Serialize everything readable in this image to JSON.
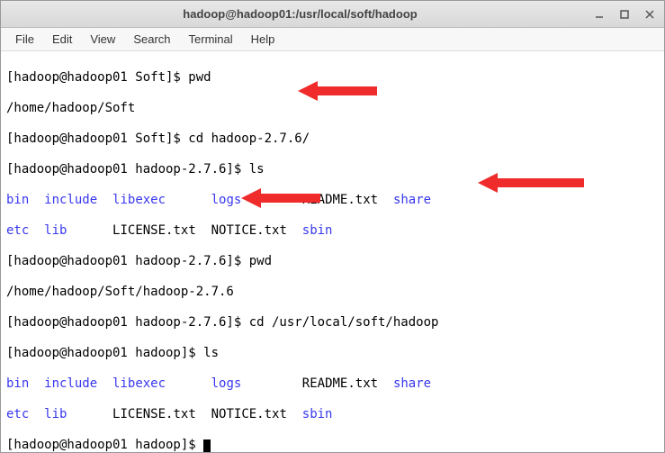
{
  "window": {
    "title": "hadoop@hadoop01:/usr/local/soft/hadoop"
  },
  "menu": {
    "file": "File",
    "edit": "Edit",
    "view": "View",
    "search": "Search",
    "terminal": "Terminal",
    "help": "Help"
  },
  "term": {
    "l1": "[hadoop@hadoop01 Soft]$ pwd",
    "l2": "/home/hadoop/Soft",
    "l3": "[hadoop@hadoop01 Soft]$ cd hadoop-2.7.6/",
    "l4": "[hadoop@hadoop01 hadoop-2.7.6]$ ls",
    "l5a": "bin",
    "l5b": "include",
    "l5c": "libexec",
    "l5d": "logs",
    "l5e": "README.txt",
    "l5f": "share",
    "l6a": "etc",
    "l6b": "lib",
    "l6c": "LICENSE.txt",
    "l6d": "NOTICE.txt",
    "l6e": "sbin",
    "l7": "[hadoop@hadoop01 hadoop-2.7.6]$ pwd",
    "l8": "/home/hadoop/Soft/hadoop-2.7.6",
    "l9": "[hadoop@hadoop01 hadoop-2.7.6]$ cd /usr/local/soft/hadoop",
    "l10": "[hadoop@hadoop01 hadoop]$ ls",
    "l11a": "bin",
    "l11b": "include",
    "l11c": "libexec",
    "l11d": "logs",
    "l11e": "README.txt",
    "l11f": "share",
    "l12a": "etc",
    "l12b": "lib",
    "l12c": "LICENSE.txt",
    "l12d": "NOTICE.txt",
    "l12e": "sbin",
    "l13": "[hadoop@hadoop01 hadoop]$ "
  }
}
